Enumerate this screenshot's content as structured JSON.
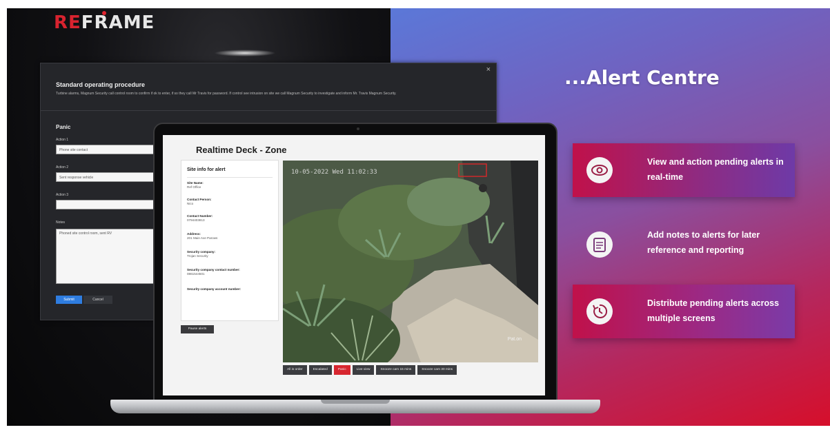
{
  "brand": {
    "logo_part1": "RE",
    "logo_part2": "FRA",
    "logo_part3": "ME"
  },
  "sop": {
    "title": "Standard operating procedure",
    "description": "Turbine alarms, Magnum Security call control room to confirm if ok to enter, if so they call Mr Travis for password. If control see intrusion on site we call Magnum Security to investigate and inform Mr. Travis Magnum Security.",
    "section_title": "Panic",
    "action1_label": "Action 1",
    "action1_value": "Phone site contact",
    "action2_label": "Action 2",
    "action2_value": "Sent response vehicle",
    "action3_label": "Action 3",
    "action3_value": "",
    "notes_label": "Notes",
    "notes_value": "Phoned site control room, sent RV",
    "submit_label": "Submit",
    "cancel_label": "Cancel",
    "close_label": "×"
  },
  "realtime": {
    "title": "Realtime Deck - Zone",
    "site_card_title": "Site info for alert",
    "fields": [
      {
        "key": "Site Name:",
        "value": "Ref Office"
      },
      {
        "key": "Contact Person:",
        "value": "Nico"
      },
      {
        "key": "Contact Number:",
        "value": "0794403813"
      },
      {
        "key": "Address:",
        "value": "201 Main Ave Parows"
      },
      {
        "key": "Security company:",
        "value": "Trojan Security"
      },
      {
        "key": "Security company contact number:",
        "value": "0861544501"
      },
      {
        "key": "Security company account number:",
        "value": ""
      }
    ],
    "pause_label": "Pause alerts",
    "camera_timestamp": "10-05-2022 Wed 11:02:33",
    "camera_name": "Pat.on",
    "controls": [
      "All is order",
      "Escalated",
      "Panic",
      "Live view",
      "Snooze cam 15 mins",
      "Snooze cam 30 mins"
    ]
  },
  "hero": {
    "headline": "...Alert Centre",
    "features": [
      {
        "icon": "eye-icon",
        "text": "View and action pending alerts in real-time"
      },
      {
        "icon": "notes-icon",
        "text": "Add notes to alerts for later reference and reporting"
      },
      {
        "icon": "clock-history-icon",
        "text": "Distribute pending alerts across multiple screens"
      }
    ]
  },
  "colors": {
    "brand_red": "#d8232f",
    "panic_red": "#d7262f",
    "submit_blue": "#2f7de0"
  }
}
